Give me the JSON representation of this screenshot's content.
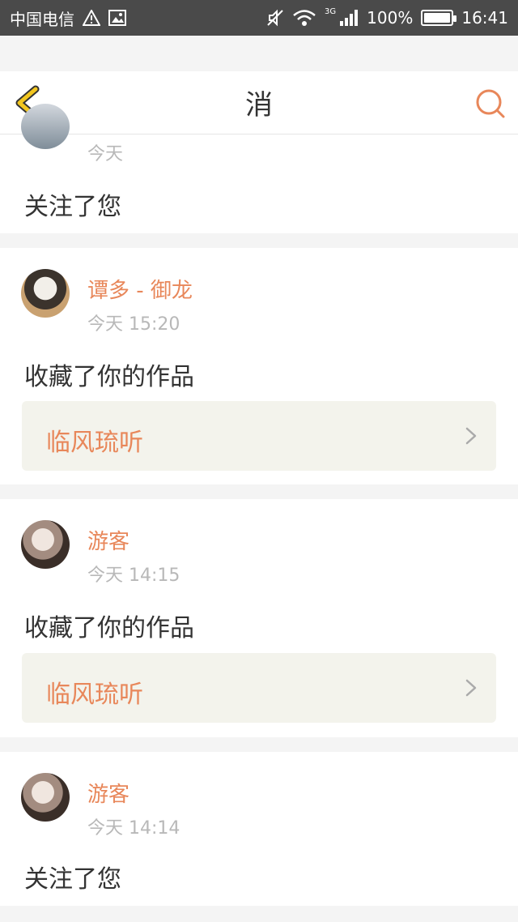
{
  "status_bar": {
    "carrier": "中国电信",
    "network": "3G",
    "battery": "100%",
    "battery_level": 1.0,
    "time": "16:41"
  },
  "header": {
    "title": "消"
  },
  "notifications": [
    {
      "username": "",
      "time": "今天",
      "action": "关注了您"
    },
    {
      "username": "谭多 - 御龙",
      "time": "今天 15:20",
      "action": "收藏了你的作品",
      "work_title": "临风琉听"
    },
    {
      "username": "游客",
      "time": "今天 14:15",
      "action": "收藏了你的作品",
      "work_title": "临风琉听"
    },
    {
      "username": "游客",
      "time": "今天 14:14",
      "action": "关注了您"
    }
  ],
  "colors": {
    "accent": "#e8875a",
    "back_arrow": "#f2c61f",
    "status_bar_bg": "#4a4a4a"
  }
}
